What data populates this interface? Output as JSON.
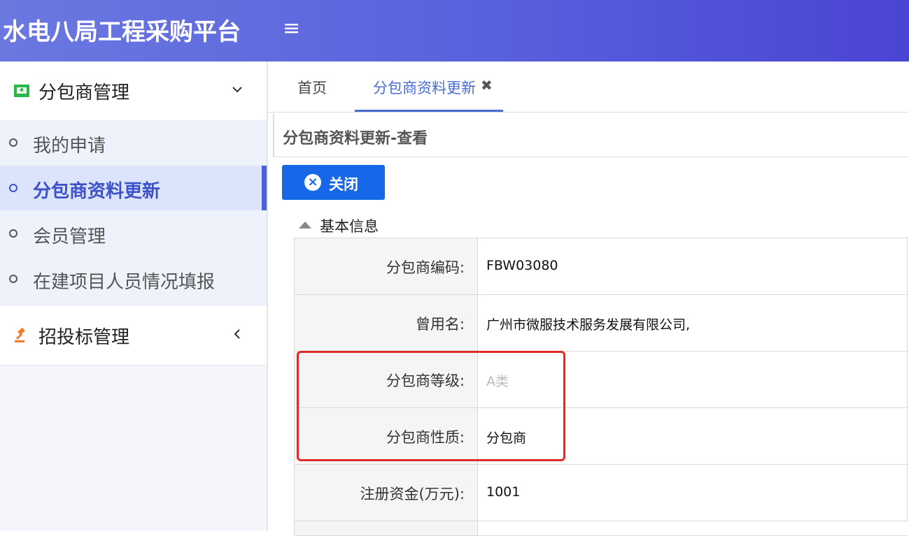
{
  "app": {
    "title": "水电八局工程采购平台",
    "menu_toggle_icon": "hamburger-icon"
  },
  "sidebar": {
    "groups": [
      {
        "label": "分包商管理",
        "icon": "id-card-icon",
        "expanded": true,
        "items": [
          {
            "label": "我的申请",
            "active": false
          },
          {
            "label": "分包商资料更新",
            "active": true
          },
          {
            "label": "会员管理",
            "active": false
          },
          {
            "label": "在建项目人员情况填报",
            "active": false
          }
        ]
      },
      {
        "label": "招投标管理",
        "icon": "gavel-icon",
        "expanded": false
      }
    ]
  },
  "tabs": [
    {
      "label": "首页",
      "active": false
    },
    {
      "label": "分包商资料更新",
      "active": true,
      "closable": true
    }
  ],
  "panel": {
    "title": "分包商资料更新-查看",
    "close_button": "关闭",
    "section": "基本信息",
    "fields": [
      {
        "label": "分包商编码:",
        "value": "FBW03080"
      },
      {
        "label": "曾用名:",
        "value": "广州市微服技术服务发展有限公司,"
      },
      {
        "label": "分包商等级:",
        "value": "A类",
        "muted": true
      },
      {
        "label": "分包商性质:",
        "value": "分包商"
      },
      {
        "label": "注册资金(万元):",
        "value": "1001"
      }
    ]
  },
  "colors": {
    "header_start": "#6b78e0",
    "header_end": "#4a44d4",
    "accent": "#4a6bd0",
    "button": "#1668e8",
    "highlight": "#e02a2a"
  }
}
